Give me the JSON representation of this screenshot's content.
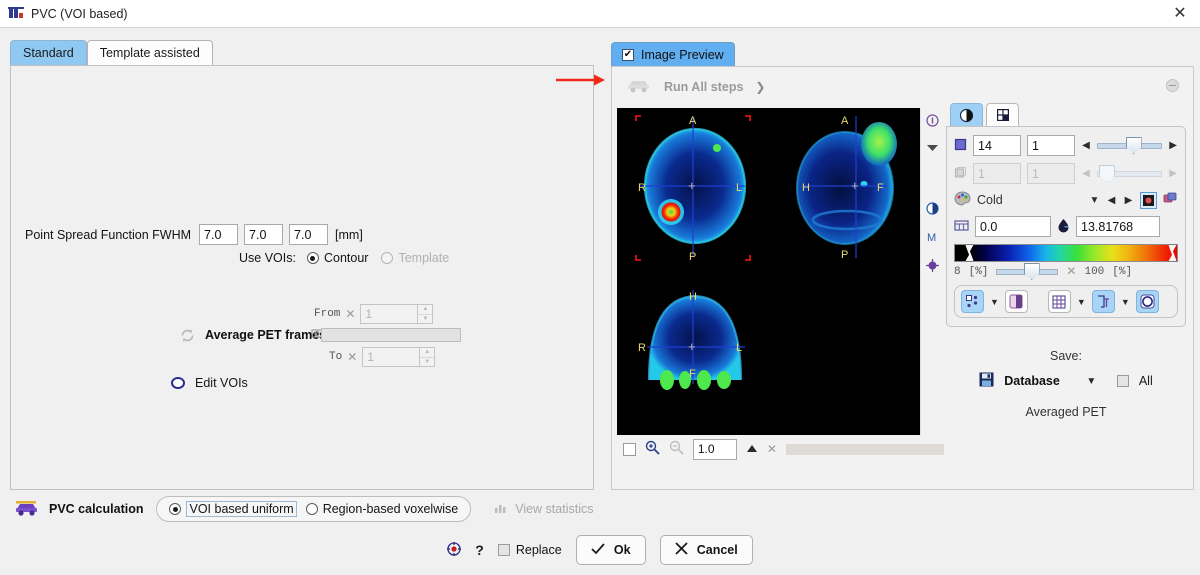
{
  "window": {
    "title": "PVC (VOI based)",
    "close_label": "✕",
    "icon": "pvc-icon"
  },
  "tabs": [
    {
      "label": "Standard",
      "active": true
    },
    {
      "label": "Template assisted",
      "active": false
    }
  ],
  "form": {
    "psf": {
      "label": "Point Spread Function FWHM",
      "x": "7.0",
      "y": "7.0",
      "z": "7.0",
      "unit": "[mm]"
    },
    "use_vois": {
      "label": "Use VOIs:",
      "options": [
        {
          "label": "Contour",
          "selected": true,
          "enabled": true
        },
        {
          "label": "Template",
          "selected": false,
          "enabled": false
        }
      ]
    },
    "average_pet_frames": {
      "label": "Average PET frames",
      "from_label": "From",
      "from_value": "1",
      "to_label": "To",
      "to_value": "1",
      "x_mark": "✕"
    },
    "edit_vois": {
      "label": "Edit VOIs",
      "checked": false
    }
  },
  "pvc_bar": {
    "title": "PVC calculation",
    "options": [
      {
        "label": "VOI based uniform",
        "selected": true
      },
      {
        "label": "Region-based voxelwise",
        "selected": false
      }
    ],
    "view_statistics": "View statistics"
  },
  "footer": {
    "help": "?",
    "replace": {
      "label": "Replace",
      "checked": false
    },
    "ok": {
      "label": "Ok",
      "icon": "check-icon"
    },
    "cancel": {
      "label": "Cancel",
      "icon": "x-icon"
    }
  },
  "image_preview": {
    "tab_label": "Image Preview",
    "tab_checked": true,
    "run_all_steps": "Run All steps",
    "run_arrow": "❯",
    "viewer": {
      "orientation_labels": {
        "transaxial": [
          "A",
          "R",
          "L",
          "P"
        ],
        "sagittal": [
          "A",
          "H",
          "F",
          "P"
        ],
        "coronal": [
          "H",
          "R",
          "L",
          "F"
        ]
      }
    },
    "viewer_side_icons": [
      "info-icon",
      "chevron-down-icon",
      "contrast-icon",
      "m-icon",
      "target-icon"
    ],
    "bottom_bar": {
      "zoom_value": "1.0",
      "zoom_in_icon": "zoom-in-icon",
      "zoom_out_icon": "zoom-out-icon",
      "triangle_icon": "triangle-up-icon",
      "close_icon": "✕"
    },
    "controls": {
      "tabs": [
        {
          "icon": "contrast-tab-icon",
          "active": true
        },
        {
          "icon": "layout-tab-icon",
          "active": false
        }
      ],
      "slice_row": {
        "value": "14",
        "max": "1",
        "enabled": true,
        "knob_pct": 44
      },
      "frame_row": {
        "value": "1",
        "max": "1",
        "enabled": false,
        "knob_pct": 3
      },
      "colormap": {
        "name": "Cold",
        "palette_icon": "palette-icon",
        "dropdown_icon": "chevron-down-icon",
        "prev_icon": "chevron-left-icon",
        "next_icon": "chevron-right-icon",
        "invert_icon": "invert-icon",
        "copy_icon": "copy-colortable-icon"
      },
      "range": {
        "min": "0.0",
        "max": "13.81768",
        "min_icon": "table-icon",
        "max_icon": "droplet-icon"
      },
      "percent": {
        "low": "8",
        "low_unit": "[%]",
        "high": "100",
        "high_unit": "[%]",
        "x_mark": "✕",
        "knob_pct": 44
      },
      "toolbar": [
        {
          "icon": "vois-icon",
          "active": true
        },
        {
          "icon": "chevron-down-icon",
          "active": false,
          "type": "arrow"
        },
        {
          "icon": "fusion-icon",
          "active": false
        },
        {
          "icon": "grid-icon",
          "active": false
        },
        {
          "icon": "chevron-down-icon",
          "active": false,
          "type": "arrow"
        },
        {
          "icon": "annotation-icon",
          "active": true
        },
        {
          "icon": "chevron-down-icon",
          "active": false,
          "type": "arrow"
        },
        {
          "icon": "circle-icon",
          "active": true
        }
      ]
    },
    "save": {
      "label": "Save:",
      "target": "Database",
      "target_icon": "floppy-disk-icon",
      "dropdown_icon": "chevron-down-icon",
      "all": {
        "label": "All",
        "checked": false
      },
      "description": "Averaged PET"
    },
    "minimize_icon": "minimize-icon"
  },
  "annotation": {
    "arrow_color": "#ef2a18"
  }
}
